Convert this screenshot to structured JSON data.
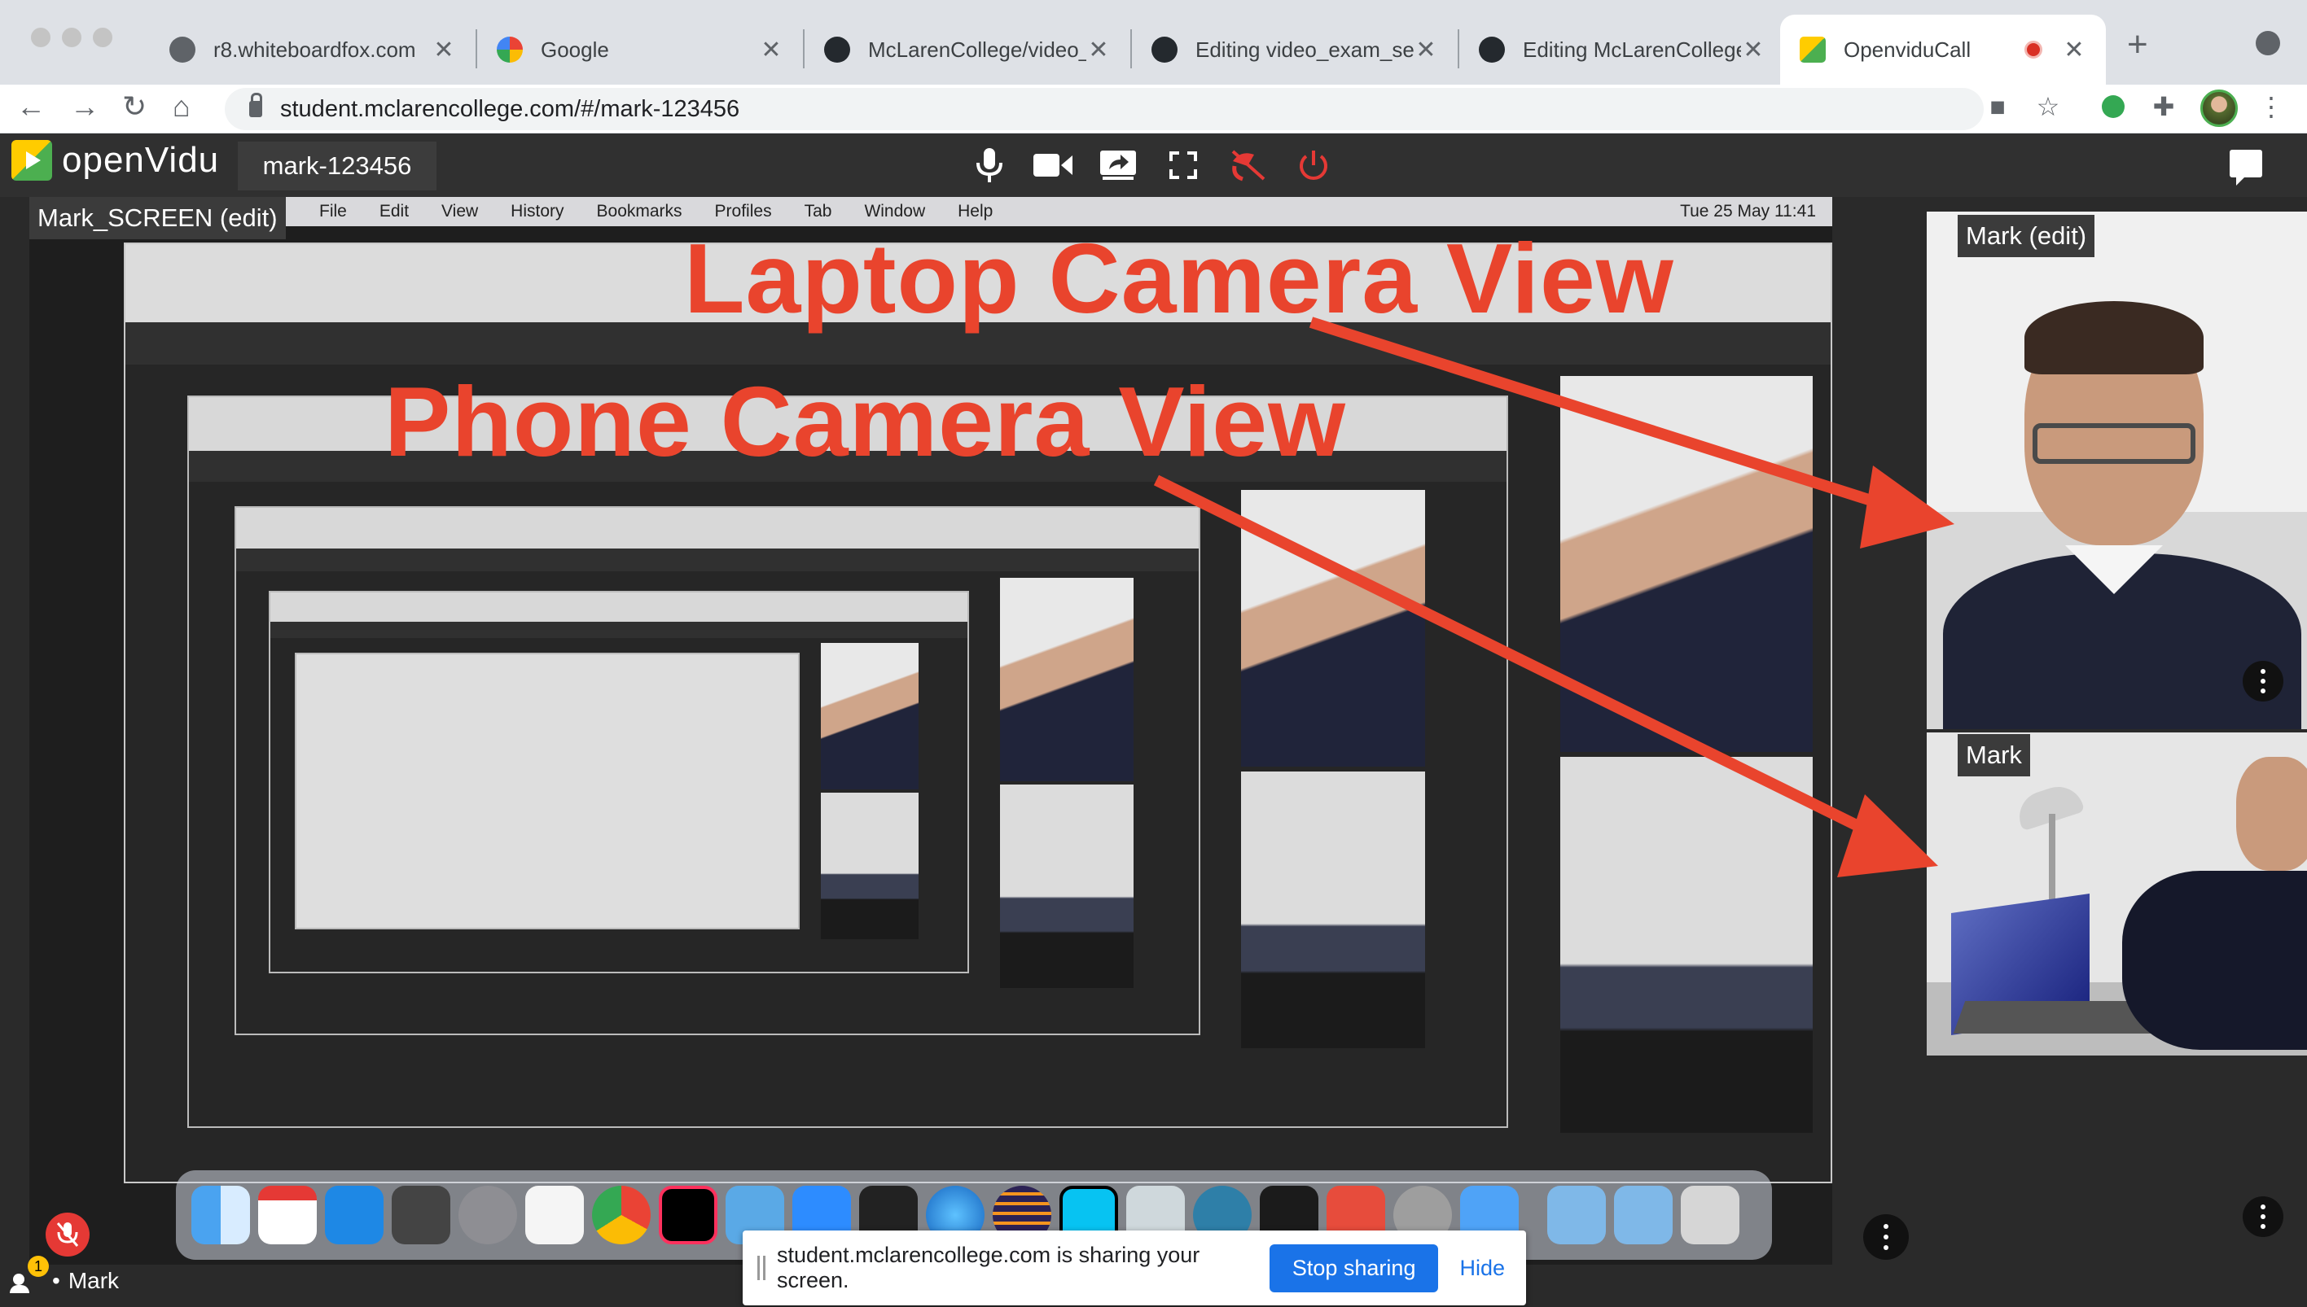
{
  "browser": {
    "tabs": [
      {
        "title": "r8.whiteboardfox.com",
        "favicon": "globe-icon"
      },
      {
        "title": "Google",
        "favicon": "google-icon"
      },
      {
        "title": "McLarenCollege/video_e",
        "favicon": "github-icon"
      },
      {
        "title": "Editing video_exam_set",
        "favicon": "github-icon"
      },
      {
        "title": "Editing McLarenCollege",
        "favicon": "github-icon"
      },
      {
        "title": "OpenviduCall",
        "favicon": "openvidu-icon",
        "active": true
      }
    ],
    "url": "student.mclarencollege.com/#/mark-123456"
  },
  "toolbar": {
    "logo_text": "openVidu",
    "session_name": "mark-123456"
  },
  "stage": {
    "screen_label": "Mark_SCREEN (edit)",
    "cam_top_label": "Mark (edit)",
    "cam_bottom_label": "Mark",
    "share_text": "student.mclarencollege.com is sharing your screen.",
    "stop_sharing": "Stop sharing",
    "hide": "Hide",
    "user_name": "Mark",
    "user_badge": "1"
  },
  "mac_menu": {
    "items": [
      "File",
      "Edit",
      "View",
      "History",
      "Bookmarks",
      "Profiles",
      "Tab",
      "Window",
      "Help"
    ],
    "clock": "Tue 25 May  11:41"
  },
  "annotations": {
    "laptop": "Laptop Camera View",
    "phone": "Phone Camera View",
    "color": "#e9442d"
  },
  "colors": {
    "ov_bar": "#303030",
    "stop_button": "#1a73e8",
    "mic_off": "#e53935"
  }
}
